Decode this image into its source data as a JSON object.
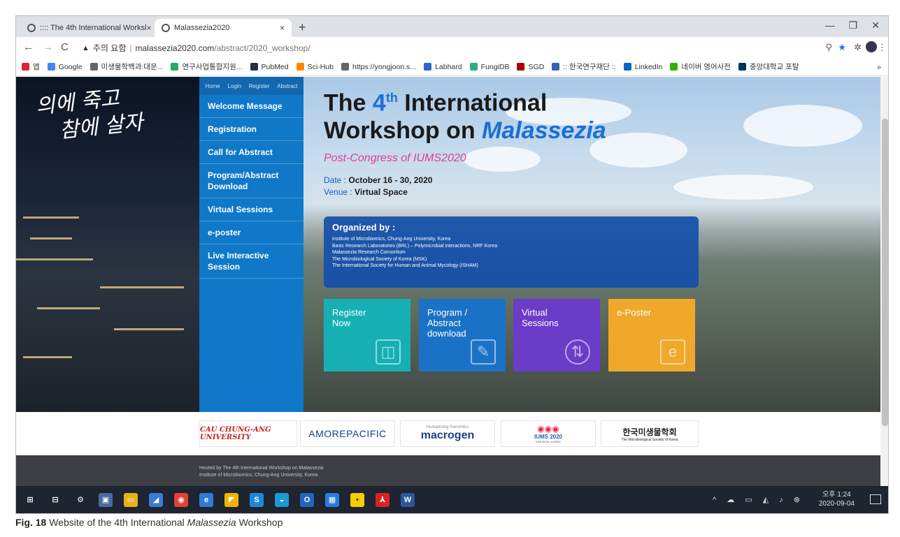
{
  "browser": {
    "tabs": [
      {
        "label": ":::: The 4th International Worksl",
        "close": "×"
      },
      {
        "label": "Malassezia2020",
        "close": "×"
      }
    ],
    "new_tab": "+",
    "window_controls": [
      "—",
      "❐",
      "✕"
    ],
    "nav": {
      "back": "←",
      "forward": "→",
      "reload": "C"
    },
    "address": {
      "warning_icon": "▲",
      "warning_text": "주의 요함",
      "domain": "malassezia2020.com",
      "path": "/abstract/2020_workshop/"
    },
    "toolbar_icons": [
      "zoom-icon",
      "star-icon",
      "extensions-icon",
      "profile-icon",
      "menu-icon"
    ],
    "bookmarks": [
      {
        "label": "앱",
        "color": "#d23"
      },
      {
        "label": "Google",
        "color": "#4285f4"
      },
      {
        "label": "미생물학백과:대문...",
        "color": "#666"
      },
      {
        "label": "연구사업통합지원...",
        "color": "#2a6"
      },
      {
        "label": "PubMed",
        "color": "#234"
      },
      {
        "label": "Sci-Hub",
        "color": "#f80"
      },
      {
        "label": "https://yongjoon.s...",
        "color": "#666"
      },
      {
        "label": "Labhard",
        "color": "#36c"
      },
      {
        "label": "FungiDB",
        "color": "#3a8"
      },
      {
        "label": "SGD",
        "color": "#a00"
      },
      {
        "label": ":: 한국연구재단 ::",
        "color": "#36a"
      },
      {
        "label": "LinkedIn",
        "color": "#0a66c2"
      },
      {
        "label": "네이버 영어사전",
        "color": "#2db400"
      },
      {
        "label": "중앙대학교 포탈",
        "color": "#036"
      }
    ],
    "bookmarks_more": "»"
  },
  "page": {
    "slogan": [
      "의에 죽고",
      "참에 살자"
    ],
    "top_nav": [
      "Home",
      "Login",
      "Register",
      "Abstract"
    ],
    "side_nav": [
      "Welcome Message",
      "Registration",
      "Call for Abstract",
      "Program/Abstract Download",
      "Virtual Sessions",
      "e-poster",
      "Live Interactive Session"
    ],
    "title": {
      "pre": "The ",
      "num": "4",
      "sup": "th",
      "post": " International",
      "line2_pre": "Workshop on ",
      "line2_em": "Malassezia"
    },
    "post_congress": "Post-Congress of IUMS2020",
    "date_label": "Date : ",
    "date_value": "October 16 - 30, 2020",
    "venue_label": "Venue : ",
    "venue_value": "Virtual Space",
    "organized_title": "Organized by :",
    "organizers": [
      "Institute of Microbiomics, Chung-Ang University, Korea",
      "Basic Research Laboratories (BRL) – Polymicrobial interactions, NRF Korea",
      "Malassezia Research Consortium",
      "The Microbiological Society of Korea (MSK)",
      "The International Society for Human and Animal Mycology (ISHAM)"
    ],
    "tiles": [
      {
        "label": "Register Now",
        "color": "#16b0b4"
      },
      {
        "label": "Program / Abstract download",
        "color": "#1a72c6"
      },
      {
        "label": "Virtual Sessions",
        "color": "#6a3cc8"
      },
      {
        "label": "e-Poster",
        "color": "#f0a82a"
      }
    ],
    "sponsors": [
      "CAU CHUNG-ANG UNIVERSITY",
      "AMOREPACIFIC",
      "macrogen",
      "IUMS 2020",
      "한국미생물학회"
    ],
    "sponsor_sub": {
      "macrogen": "Humanizing Genomics",
      "msk": "The Microbiological Society of Korea",
      "iums": "DAEJEON, KOREA"
    },
    "footer": [
      "Hosted by The 4th International Workshop on Malassezia",
      "Institute of Microbiomics, Chung-Ang University, Korea"
    ]
  },
  "taskbar": {
    "apps": [
      "start-icon",
      "task-view-icon",
      "settings-icon",
      "photos-icon",
      "file-explorer-icon",
      "notes-icon",
      "chrome-icon",
      "ie-icon",
      "sticky-icon",
      "skype-icon",
      "edge-icon",
      "outlook-icon",
      "calendar-icon",
      "kakaotalk-icon",
      "acrobat-icon",
      "word-icon"
    ],
    "time": "오후 1:24",
    "date": "2020-09-04"
  },
  "caption": {
    "label": "Fig. 18",
    "text_pre": " Website of the 4th International ",
    "text_em": "Malassezia",
    "text_post": " Workshop"
  }
}
